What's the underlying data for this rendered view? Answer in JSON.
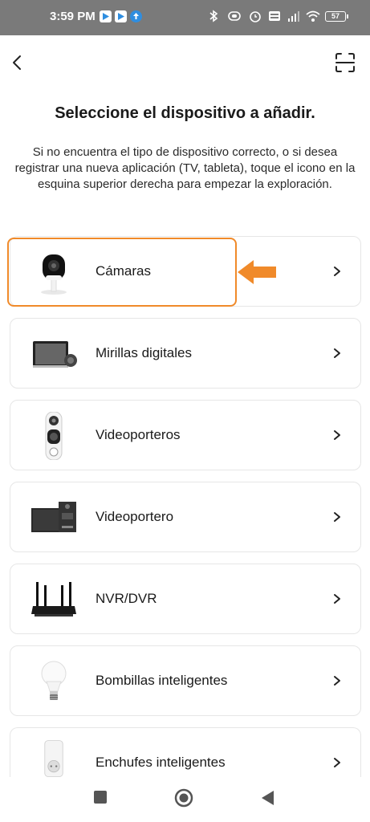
{
  "statusbar": {
    "time": "3:59 PM",
    "battery": "57"
  },
  "header": {
    "title": "Seleccione el dispositivo a añadir.",
    "subtitle": "Si no encuentra el tipo de dispositivo correcto, o si desea registrar una nueva aplicación (TV, tableta), toque el icono en la esquina superior derecha para empezar la exploración."
  },
  "devices": [
    {
      "label": "Cámaras",
      "icon": "indoor-camera-icon"
    },
    {
      "label": "Mirillas digitales",
      "icon": "digital-peephole-icon"
    },
    {
      "label": "Videoporteros",
      "icon": "video-doorbell-icon"
    },
    {
      "label": "Videoportero",
      "icon": "video-intercom-icon"
    },
    {
      "label": "NVR/DVR",
      "icon": "nvr-recorder-icon"
    },
    {
      "label": "Bombillas inteligentes",
      "icon": "smart-bulb-icon"
    },
    {
      "label": "Enchufes inteligentes",
      "icon": "smart-plug-icon"
    }
  ],
  "colors": {
    "accent": "#f08a2a",
    "statusbar": "#7a7a7a",
    "card_border": "#e6e6e6"
  }
}
